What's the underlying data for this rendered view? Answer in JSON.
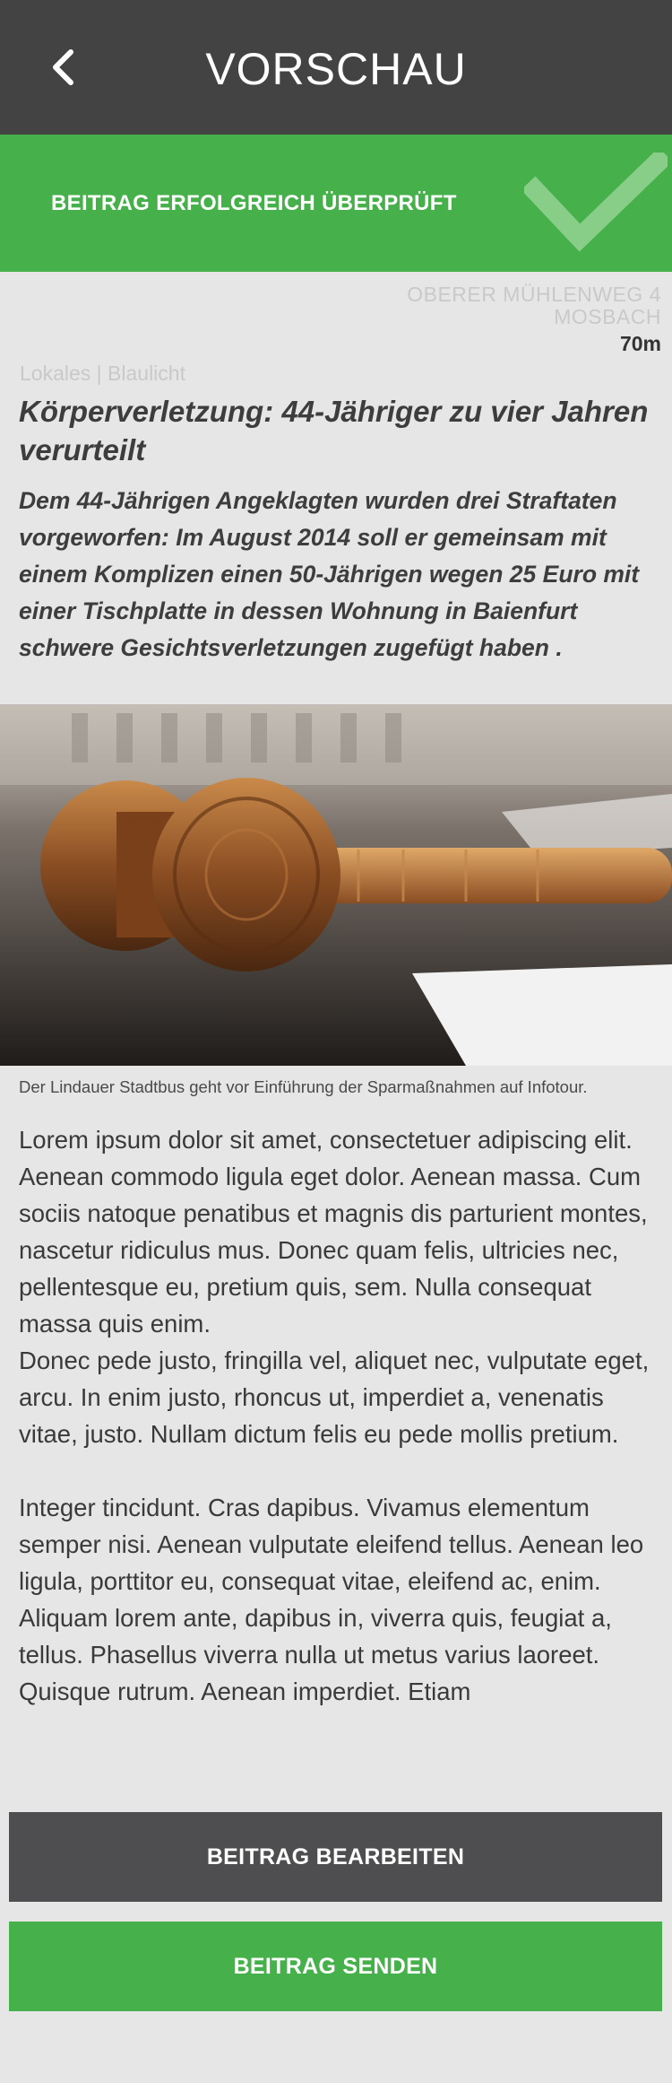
{
  "header": {
    "title": "VORSCHAU",
    "back_icon": "chevron-left-icon"
  },
  "banner": {
    "text": "BEITRAG ERFOLGREICH ÜBERPRÜFT",
    "icon": "checkmark-icon",
    "color": "#46b04a"
  },
  "location": {
    "street": "OBERER MÜHLENWEG 4",
    "city": "MOSBACH",
    "distance": "70m"
  },
  "article": {
    "categories": "Lokales | Blaulicht",
    "headline": "Körperverletzung: 44-Jähriger zu vier Jahren verurteilt",
    "lead": "Dem 44-Jährigen Angeklagten wurden drei Straftaten vorgeworfen: Im August 2014 soll er gemeinsam mit einem Komplizen einen 50-Jährigen wegen 25 Euro mit einer Tischplatte in dessen Wohnung in Baienfurt schwere Gesichtsverletzungen zugefügt haben .",
    "image_caption": "Der Lindauer Stadtbus geht vor Einführung der Sparmaßnahmen auf Infotour.",
    "body": [
      "Lorem ipsum dolor sit amet, consectetuer adipiscing elit. Aenean commodo ligula eget dolor. Aenean massa. Cum sociis natoque penatibus et magnis dis parturient montes, nascetur ridiculus mus. Donec quam felis, ultricies nec, pellentesque eu, pretium quis, sem. Nulla consequat massa quis enim.",
      "Donec pede justo, fringilla vel, aliquet nec, vulputate eget, arcu. In enim justo, rhoncus ut, imperdiet a, venenatis vitae, justo. Nullam dictum felis eu pede mollis pretium.",
      "Integer tincidunt. Cras dapibus. Vivamus elementum semper nisi. Aenean vulputate eleifend tellus. Aenean leo ligula, porttitor eu, consequat vitae, eleifend ac, enim. Aliquam lorem ante, dapibus in, viverra quis, feugiat a, tellus. Phasellus viverra nulla ut metus varius laoreet. Quisque rutrum. Aenean imperdiet. Etiam"
    ]
  },
  "actions": {
    "edit_label": "BEITRAG BEARBEITEN",
    "send_label": "BEITRAG SENDEN"
  },
  "colors": {
    "header_bg": "#434343",
    "accent_green": "#46b04a",
    "edit_button_bg": "#4e4e50",
    "page_bg": "#e6e6e6"
  }
}
